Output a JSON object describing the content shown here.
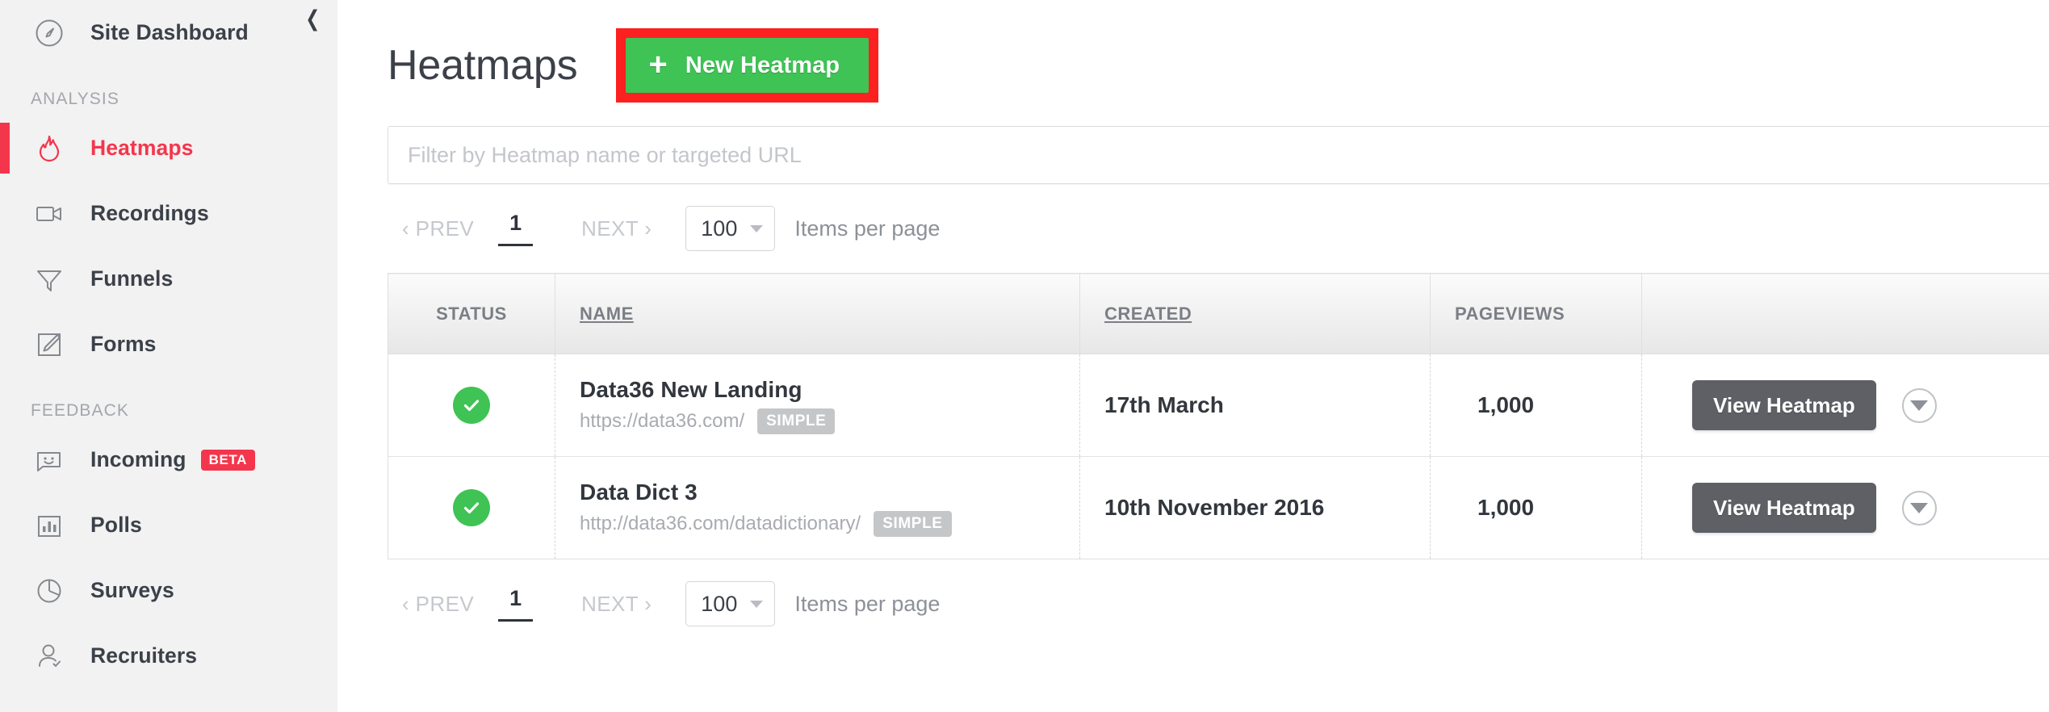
{
  "sidebar": {
    "collapse_icon": "chevron-left-icon",
    "top_items": [
      {
        "label": "Site Dashboard",
        "icon": "speedometer-icon",
        "active": false
      }
    ],
    "sections": [
      {
        "label": "ANALYSIS",
        "items": [
          {
            "label": "Heatmaps",
            "icon": "flame-icon",
            "active": true
          },
          {
            "label": "Recordings",
            "icon": "video-camera-icon",
            "active": false
          },
          {
            "label": "Funnels",
            "icon": "funnel-icon",
            "active": false
          },
          {
            "label": "Forms",
            "icon": "pencil-square-icon",
            "active": false
          }
        ]
      },
      {
        "label": "FEEDBACK",
        "items": [
          {
            "label": "Incoming",
            "icon": "speech-bubble-smiley-icon",
            "active": false,
            "badge": "BETA"
          },
          {
            "label": "Polls",
            "icon": "bar-chart-icon",
            "active": false
          },
          {
            "label": "Surveys",
            "icon": "pie-chart-icon",
            "active": false
          },
          {
            "label": "Recruiters",
            "icon": "user-check-icon",
            "active": false
          }
        ]
      }
    ]
  },
  "header": {
    "title": "Heatmaps",
    "new_button": {
      "label": "New Heatmap",
      "icon": "plus-icon",
      "color": "#3ec354",
      "highlight_color": "#fc2020"
    }
  },
  "filter": {
    "placeholder": "Filter by Heatmap name or targeted URL",
    "value": ""
  },
  "pagination": {
    "prev_label": "‹ PREV",
    "page": "1",
    "next_label": "NEXT ›",
    "per_page": "100",
    "per_page_label": "Items per page"
  },
  "table": {
    "columns": [
      {
        "key": "status",
        "label": "STATUS",
        "sortable": false
      },
      {
        "key": "name",
        "label": "NAME",
        "sortable": true
      },
      {
        "key": "created",
        "label": "CREATED",
        "sortable": true
      },
      {
        "key": "views",
        "label": "PAGEVIEWS",
        "sortable": false
      },
      {
        "key": "actions",
        "label": "",
        "sortable": false
      }
    ],
    "rows": [
      {
        "status": "active",
        "status_icon": "check-circle-icon",
        "name": "Data36 New Landing",
        "url": "https://data36.com/",
        "tag": "SIMPLE",
        "created": "17th March",
        "pageviews": "1,000",
        "action_label": "View Heatmap",
        "menu_icon": "chevron-down-circle-icon"
      },
      {
        "status": "active",
        "status_icon": "check-circle-icon",
        "name": "Data Dict 3",
        "url": "http://data36.com/datadictionary/",
        "tag": "SIMPLE",
        "created": "10th November 2016",
        "pageviews": "1,000",
        "action_label": "View Heatmap",
        "menu_icon": "chevron-down-circle-icon"
      }
    ]
  },
  "colors": {
    "accent_red": "#f4364c",
    "success_green": "#3ec354",
    "highlight_red": "#fc2020",
    "button_grey": "#5e6066",
    "sidebar_bg": "#f2f2f2"
  }
}
